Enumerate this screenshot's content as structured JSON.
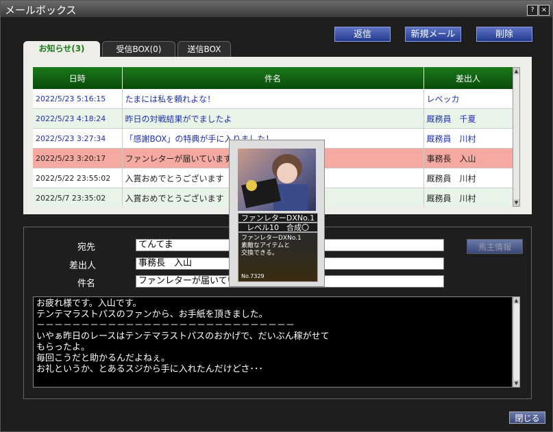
{
  "window": {
    "title": "メールボックス",
    "help_label": "?",
    "close_label": "×"
  },
  "toolbar": {
    "reply_label": "返信",
    "new_label": "新規メール",
    "delete_label": "削除"
  },
  "tabs": [
    {
      "label": "お知らせ(3)",
      "active": true
    },
    {
      "label": "受信BOX(0)",
      "active": false
    },
    {
      "label": "送信BOX",
      "active": false
    }
  ],
  "mail_list": {
    "columns": [
      "日時",
      "件名",
      "差出人"
    ],
    "rows": [
      {
        "date": "2022/5/23 5:16:15",
        "subject": "たまには私を頼れよな！",
        "sender": "レベッカ",
        "unread": true
      },
      {
        "date": "2022/5/23 4:18:24",
        "subject": "昨日の対戦結果がでましたよ",
        "sender": "厩務員　千夏",
        "unread": true
      },
      {
        "date": "2022/5/23 3:27:34",
        "subject": "「感謝BOX」の特典が手に入りました！",
        "sender": "厩務員　川村",
        "unread": true
      },
      {
        "date": "2022/5/23 3:20:17",
        "subject": "ファンレターが届いています。",
        "sender": "事務長　入山",
        "unread": false,
        "selected": true
      },
      {
        "date": "2022/5/22 23:55:02",
        "subject": "入賞おめでとうございます",
        "sender": "厩務員　川村",
        "unread": false
      },
      {
        "date": "2022/5/7 23:35:02",
        "subject": "入賞おめでとうございます",
        "sender": "厩務員　川村",
        "unread": false
      }
    ]
  },
  "detail": {
    "to_label": "宛先",
    "to_value": "てんてま",
    "from_label": "差出人",
    "from_value": "事務長　入山",
    "subject_label": "件名",
    "subject_value": "ファンレターが届いています。",
    "agent_button": "馬主情報",
    "body_lines": [
      "お疲れ様です。入山です。",
      "テンテマラストパスのファンから、お手紙を頂きました。",
      "",
      "－－－－－－－－－－－－－－－－－－－－－－－－－－－－－",
      "いやぁ昨日のレースはテンテマラストパスのおかげで、だいぶん稼がせて",
      "もらったよ。",
      "毎回こうだと助かるんだよねぇ。",
      "",
      "お礼というか、とあるスジから手に入れたんだけどさ･･･"
    ]
  },
  "card": {
    "name": "ファンレターDXNo.1",
    "level": "レベル10　合成〇",
    "desc_lines": [
      "ファンレターDXNo.1",
      "素敵なアイテムと",
      "交換できる。"
    ],
    "number": "No.7329"
  },
  "footer": {
    "close_label": "閉じる"
  },
  "colors": {
    "header_green": "#1a7a1a",
    "unread_blue": "#1f2fa8",
    "selected_row": "#f5a9a0"
  }
}
